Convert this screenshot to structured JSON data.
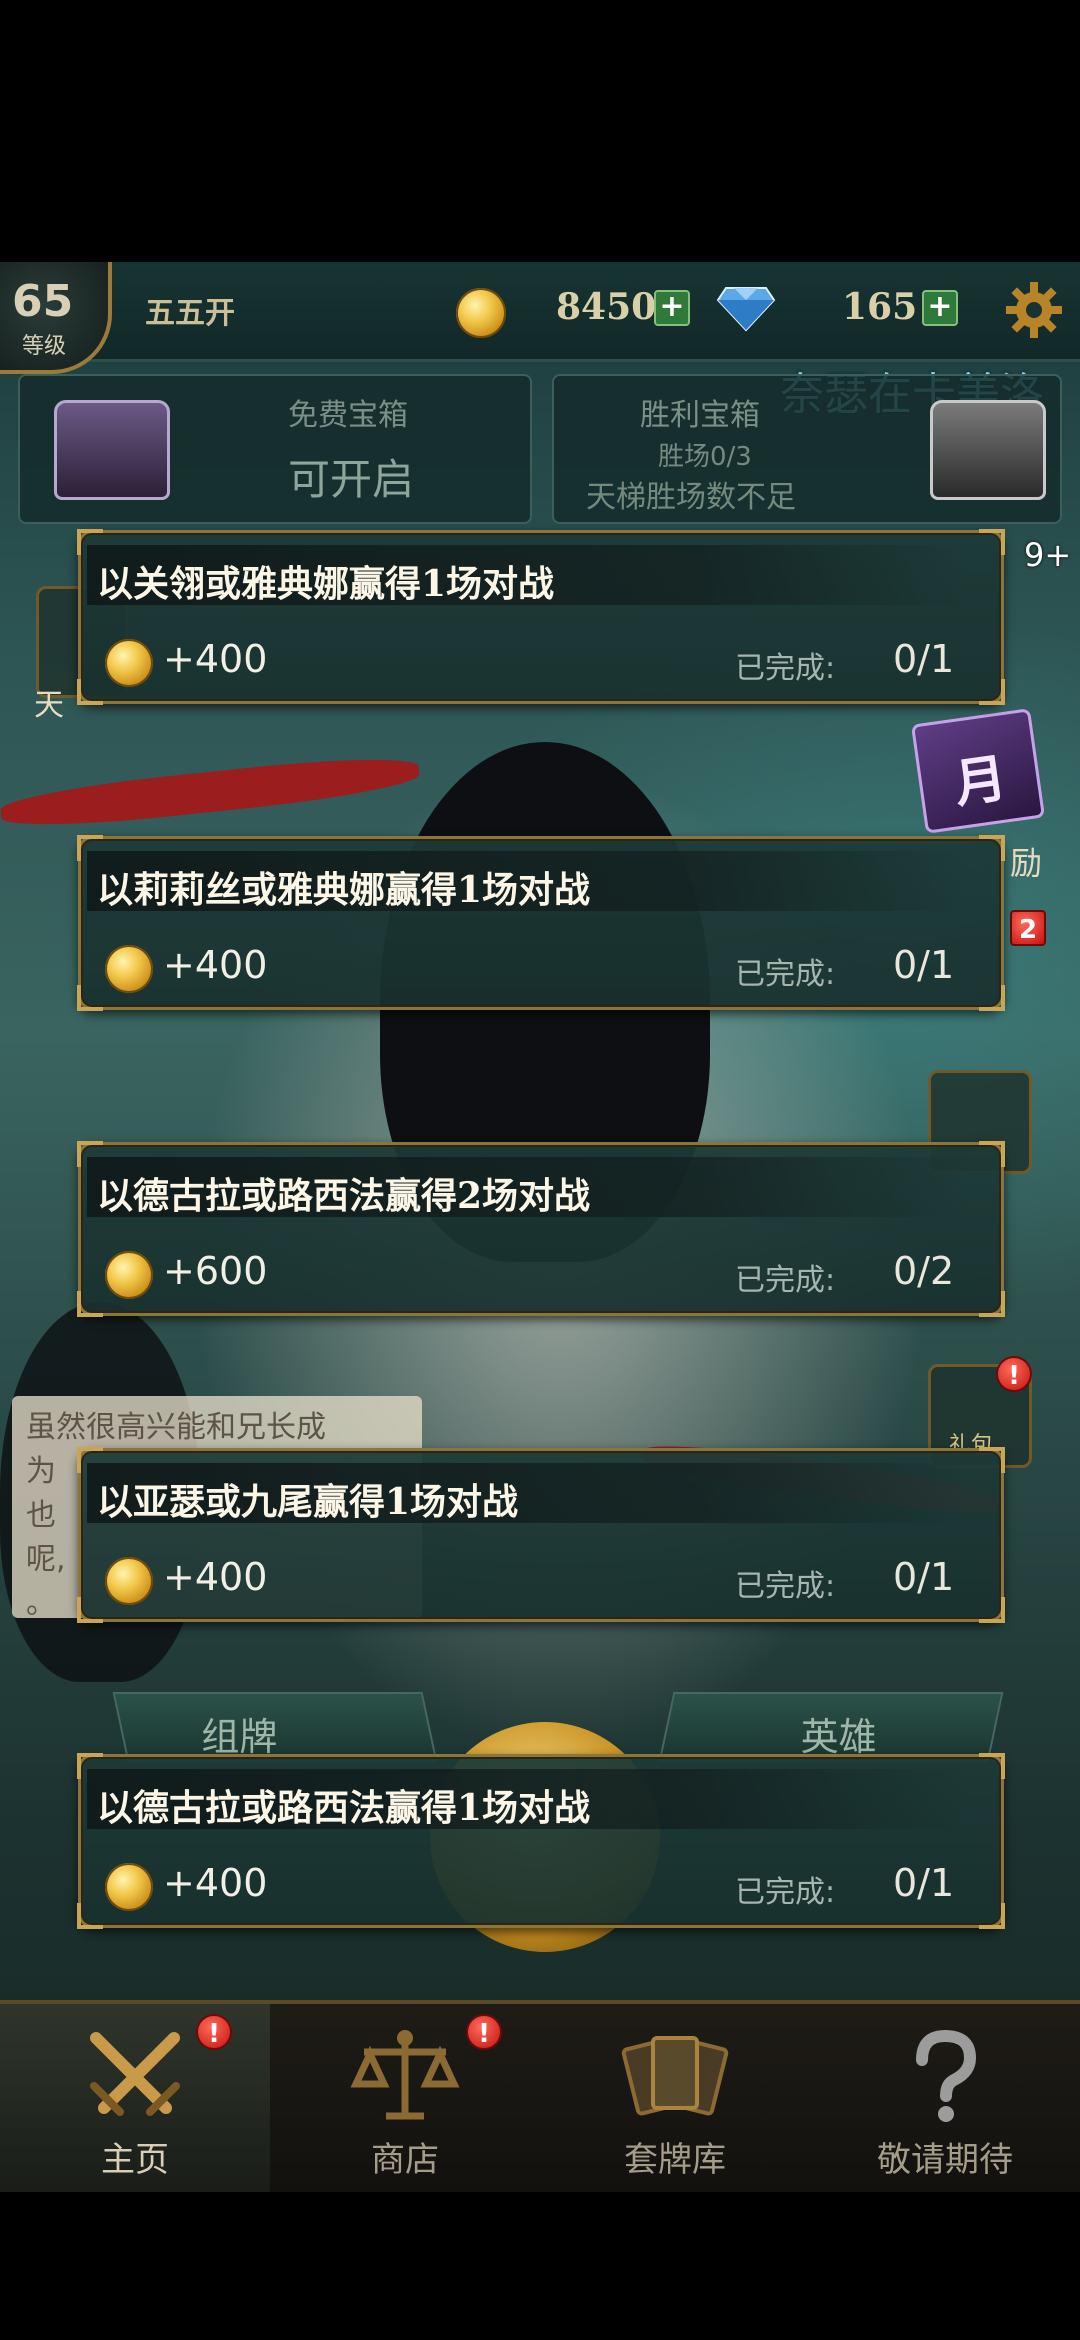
{
  "top_bar": {
    "level_value": "65",
    "level_label": "等级",
    "player_name": "五五开",
    "gold_amount": "8450",
    "gem_amount": "165",
    "plus_symbol": "+"
  },
  "marquee_text": "奈瑟在卡美洛",
  "chests": {
    "free": {
      "title": "免费宝箱",
      "status": "可开启"
    },
    "win": {
      "title": "胜利宝箱",
      "progress": "胜场0/3",
      "status": "天梯胜场数不足"
    }
  },
  "quests": [
    {
      "title": "以关翎或雅典娜赢得1场对战",
      "reward": "+400",
      "progress_label": "已完成:",
      "progress_value": "0/1",
      "completed_fraction": 0.0
    },
    {
      "title": "以莉莉丝或雅典娜赢得1场对战",
      "reward": "+400",
      "progress_label": "已完成:",
      "progress_value": "0/1",
      "completed_fraction": 0.0
    },
    {
      "title": "以德古拉或路西法赢得2场对战",
      "reward": "+600",
      "progress_label": "已完成:",
      "progress_value": "0/2",
      "completed_fraction": 0.0
    },
    {
      "title": "以亚瑟或九尾赢得1场对战",
      "reward": "+400",
      "progress_label": "已完成:",
      "progress_value": "0/1",
      "completed_fraction": 0.0
    },
    {
      "title": "以德古拉或路西法赢得1场对战",
      "reward": "+400",
      "progress_label": "已完成:",
      "progress_value": "0/1",
      "completed_fraction": 0.0
    }
  ],
  "background_partial": {
    "side_badge": "9+",
    "reward_fragment": "励",
    "month_card_char": "月",
    "badge_2": "2",
    "gift_fragment": "礼包",
    "left_fragment": "天",
    "speech_lines": [
      "虽然很高兴能和兄长成",
      "为",
      "也",
      "呢,",
      "。"
    ],
    "alert": "!"
  },
  "mid_tabs": {
    "deck": "组牌",
    "heroes": "英雄"
  },
  "bottom_nav": [
    {
      "label": "主页",
      "icon": "crossed-swords-icon",
      "active": true,
      "badge": "!"
    },
    {
      "label": "商店",
      "icon": "scales-icon",
      "active": false,
      "badge": "!"
    },
    {
      "label": "套牌库",
      "icon": "card-deck-icon",
      "active": false
    },
    {
      "label": "敬请期待",
      "icon": "question-mark-icon",
      "active": false
    }
  ],
  "colors": {
    "gold": "#f2c84a",
    "quest_border": "#8a7636",
    "marquee": "#7fd6f0",
    "alert_red": "#c3120e"
  }
}
